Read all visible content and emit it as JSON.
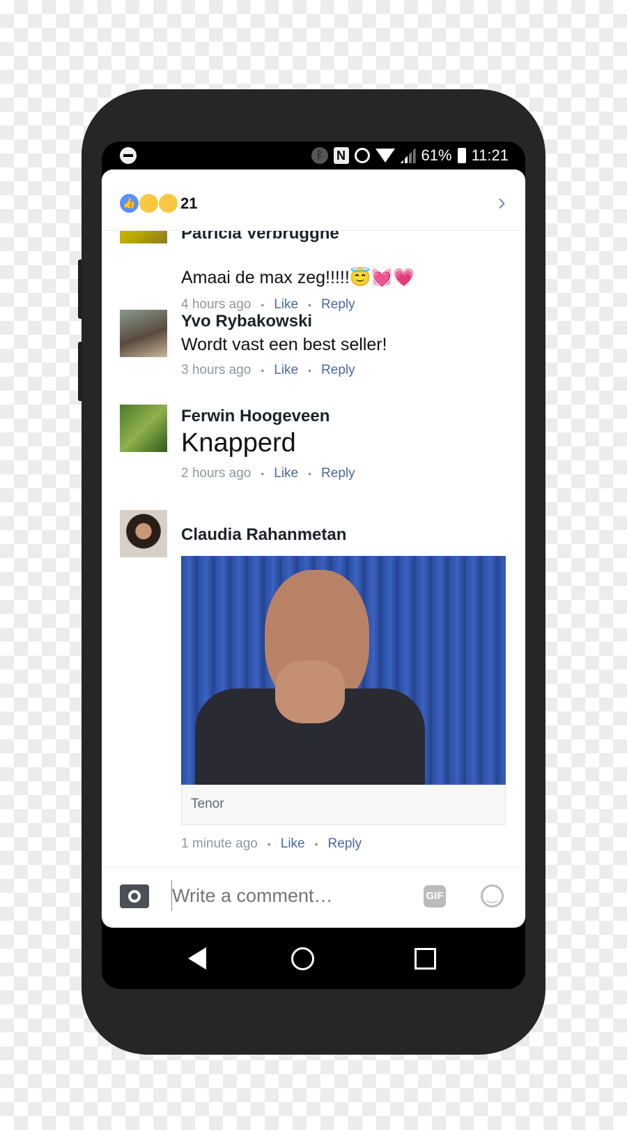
{
  "status_bar": {
    "battery": "61%",
    "time": "11:21",
    "icons": [
      "do-not-disturb-icon",
      "bluetooth-icon",
      "nfc-icon",
      "alarm-icon",
      "wifi-icon",
      "signal-icon",
      "battery-icon"
    ]
  },
  "header": {
    "reactions": [
      "like",
      "haha",
      "wow"
    ],
    "reaction_count": "21"
  },
  "comments": [
    {
      "name": "Patricia Verbrugghe",
      "text": "Amaai de max zeg!!!!!😇💓💗",
      "time": "4 hours ago",
      "like": "Like",
      "reply": "Reply"
    },
    {
      "name": "Yvo Rybakowski",
      "text": "Wordt vast een best seller!",
      "time": "3 hours ago",
      "like": "Like",
      "reply": "Reply"
    },
    {
      "name": "Ferwin Hoogeveen",
      "text": "Knapperd",
      "time": "2 hours ago",
      "like": "Like",
      "reply": "Reply"
    },
    {
      "name": "Claudia Rahanmetan",
      "attachment_source": "Tenor",
      "time": "1 minute ago",
      "like": "Like",
      "reply": "Reply"
    }
  ],
  "composer": {
    "placeholder": "Write a comment…",
    "gif_label": "GIF"
  },
  "colors": {
    "link": "#4b67a1",
    "like_blue": "#5890ff",
    "phone": "#262626"
  }
}
